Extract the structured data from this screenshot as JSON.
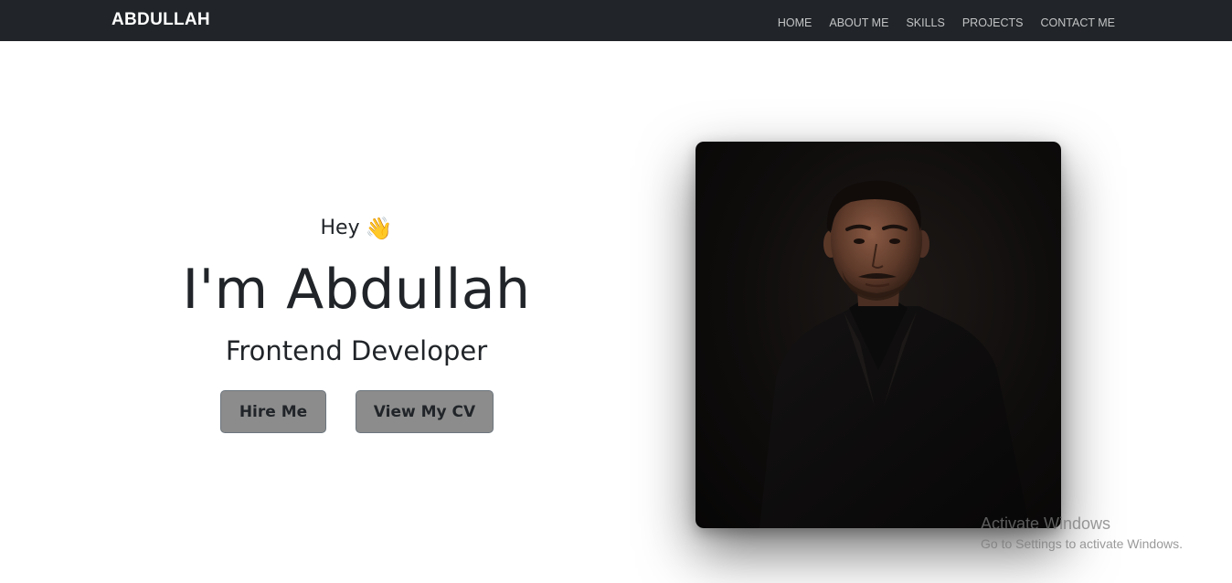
{
  "navbar": {
    "brand": "ABDULLAH",
    "links": [
      "HOME",
      "ABOUT ME",
      "SKILLS",
      "PROJECTS",
      "CONTACT ME"
    ]
  },
  "hero": {
    "greeting": "Hey",
    "wave_emoji": "👋",
    "name": "I'm Abdullah",
    "role": "Frontend Developer",
    "buttons": {
      "hire": "Hire Me",
      "cv": "View My CV"
    }
  },
  "photo": {
    "icon": "portrait-photo"
  },
  "watermark": {
    "title": "Activate Windows",
    "subtitle": "Go to Settings to activate Windows."
  },
  "colors": {
    "navbar_bg": "#212529",
    "button_bg": "#8c8c8c",
    "text": "#212529"
  }
}
